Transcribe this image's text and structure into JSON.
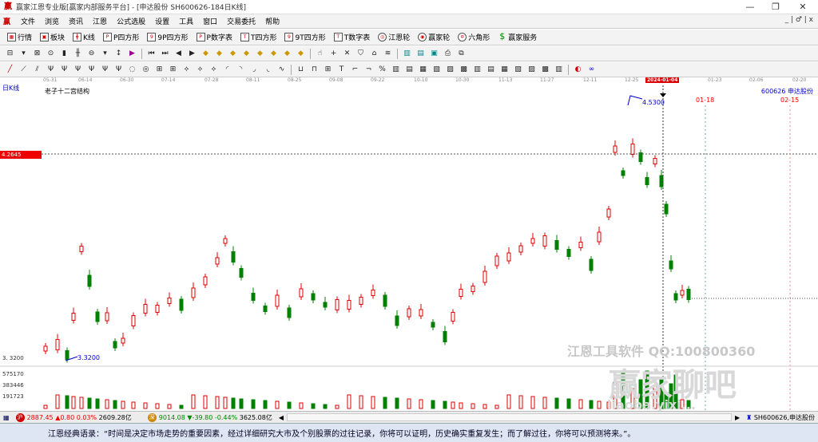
{
  "window": {
    "title": "赢家江恩专业版[赢家内部服务平台] - [申达股份  SH600626-184日K线]",
    "minimize": "—",
    "restore": "❐",
    "close": "✕"
  },
  "menu": {
    "items": [
      "文件",
      "浏览",
      "资讯",
      "江恩",
      "公式选股",
      "设置",
      "工具",
      "窗口",
      "交易委托",
      "帮助"
    ],
    "mdi_controls": "_ | ♂ | x"
  },
  "toolbar1": {
    "items": [
      {
        "label": "行情",
        "icon": "grid-icon"
      },
      {
        "label": "板块",
        "icon": "blocks-icon"
      },
      {
        "label": "K线",
        "icon": "candle-icon"
      },
      {
        "label": "P四方形",
        "icon": "square-icon"
      },
      {
        "label": "9P四方形",
        "icon": "square-icon"
      },
      {
        "label": "P数字表",
        "icon": "table-icon"
      },
      {
        "label": "T四方形",
        "icon": "square-icon"
      },
      {
        "label": "9T四方形",
        "icon": "square-icon"
      },
      {
        "label": "T数字表",
        "icon": "table-icon"
      },
      {
        "label": "江恩轮",
        "icon": "wheel-icon"
      },
      {
        "label": "赢家轮",
        "icon": "wheel-icon"
      },
      {
        "label": "六角形",
        "icon": "hexagon-icon"
      },
      {
        "label": "赢家服务",
        "icon": "dollar-icon"
      }
    ]
  },
  "chart": {
    "period_label": "日K线",
    "structure_label": "老子十二宫结构",
    "stock_label": "600626  申达股份",
    "current_price_flag": "4.2645",
    "high_label": "4.5300",
    "low_label": "3.3200",
    "y_axis_low": "3. 3200",
    "date_annotations": [
      "01-18",
      "02-15"
    ],
    "volume_labels": [
      "575170",
      "383446",
      "191723"
    ],
    "time_ticks": [
      "05-31",
      "06-14",
      "06-30",
      "07-14",
      "07-28",
      "08-11",
      "08-25",
      "09-08",
      "09-22",
      "10-10",
      "10-30",
      "11-13",
      "11-27",
      "12-11",
      "12-25",
      "2024-01-04",
      "01-23",
      "02-06",
      "02-20"
    ],
    "colors": {
      "up": "#e00000",
      "down": "#008000",
      "cursor": "#000000",
      "annotation_blue": "#0000cc",
      "annotation_red": "#e00000"
    },
    "chart_data": {
      "type": "candlestick",
      "ylim": [
        3.32,
        4.53
      ],
      "grid": false
    }
  },
  "watermarks": {
    "software": "江恩工具软件  QQ:100800360",
    "brand": "赢家聊吧",
    "sub": "liaoba.yixi..."
  },
  "statusbar": {
    "sh_index": "2887.45",
    "sh_change": "▲0.80 0.03%",
    "sh_amount": "2609.28亿",
    "sz_index": "9014.08",
    "sz_change": "▼-39.80 -0.44%",
    "sz_amount": "3625.08亿",
    "stock": "SH600626,申达股份"
  },
  "quote": {
    "text": "江恩经典语录：“时间是决定市场走势的重要因素，经过详细研究大市及个别股票的过往记录，你将可以证明，历史确实重复发生；而了解过往，你将可以预测将来。”。"
  }
}
